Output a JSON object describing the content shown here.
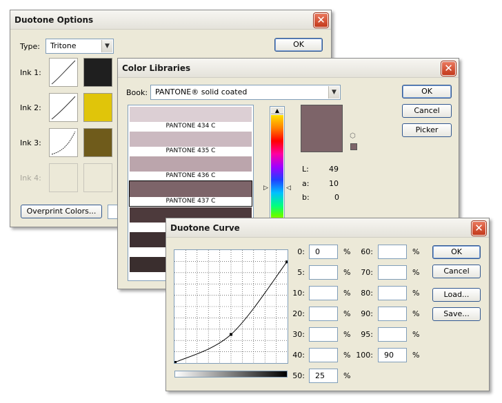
{
  "duotone_options": {
    "title": "Duotone Options",
    "close_symbol": "✕",
    "type_label": "Type:",
    "type_value": "Tritone",
    "ok_label": "OK",
    "inks": [
      {
        "label": "Ink 1:",
        "color": "#1f1f1f",
        "enabled": true
      },
      {
        "label": "Ink 2:",
        "color": "#e0c50a",
        "enabled": true
      },
      {
        "label": "Ink 3:",
        "color": "#6f5b1b",
        "enabled": true
      },
      {
        "label": "Ink 4:",
        "color": "",
        "enabled": false
      }
    ],
    "overprint_label": "Overprint Colors..."
  },
  "color_libraries": {
    "title": "Color Libraries",
    "close_symbol": "✕",
    "book_label": "Book:",
    "book_value": "PANTONE® solid coated",
    "buttons": {
      "ok": "OK",
      "cancel": "Cancel",
      "picker": "Picker"
    },
    "swatches": [
      {
        "name": "PANTONE 434 C",
        "color": "#dccfd4"
      },
      {
        "name": "PANTONE 435 C",
        "color": "#cbb9c0"
      },
      {
        "name": "PANTONE 436 C",
        "color": "#bba5ac"
      },
      {
        "name": "PANTONE 437 C",
        "color": "#7d6469",
        "selected": true
      },
      {
        "name": "",
        "color": "#4d3a3c"
      },
      {
        "name": "",
        "color": "#3e3032"
      },
      {
        "name": "",
        "color": "#3a2e2e"
      }
    ],
    "preview_color": "#7d6469",
    "lab": {
      "l_label": "L:",
      "l_value": "49",
      "a_label": "a:",
      "a_value": "10",
      "b_label": "b:",
      "b_value": "0"
    }
  },
  "duotone_curve": {
    "title": "Duotone Curve",
    "close_symbol": "✕",
    "curve_points": [
      {
        "input": 0,
        "output": 0
      },
      {
        "input": 50,
        "output": 25
      },
      {
        "input": 100,
        "output": 90
      }
    ],
    "left_fields": [
      {
        "label": "0:",
        "value": "0"
      },
      {
        "label": "5:",
        "value": ""
      },
      {
        "label": "10:",
        "value": ""
      },
      {
        "label": "20:",
        "value": ""
      },
      {
        "label": "30:",
        "value": ""
      },
      {
        "label": "40:",
        "value": ""
      },
      {
        "label": "50:",
        "value": "25"
      }
    ],
    "right_fields": [
      {
        "label": "60:",
        "value": ""
      },
      {
        "label": "70:",
        "value": ""
      },
      {
        "label": "80:",
        "value": ""
      },
      {
        "label": "90:",
        "value": ""
      },
      {
        "label": "95:",
        "value": ""
      },
      {
        "label": "100:",
        "value": "90"
      }
    ],
    "percent": "%",
    "buttons": {
      "ok": "OK",
      "cancel": "Cancel",
      "load": "Load...",
      "save": "Save..."
    }
  }
}
